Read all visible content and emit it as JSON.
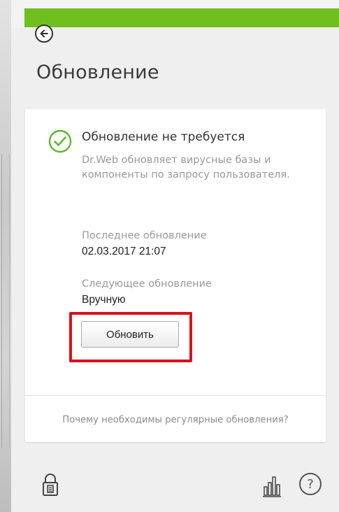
{
  "header": {
    "title": "Обновление",
    "back_icon": "arrow-left-icon",
    "accent_color": "#6fbf1f"
  },
  "status": {
    "icon": "check-circle-icon",
    "icon_color": "#5cb82a",
    "title": "Обновление не требуется",
    "description": "Dr.Web обновляет вирусные базы и компоненты по запросу пользователя."
  },
  "last_update": {
    "label": "Последнее обновление",
    "value": "02.03.2017 21:07"
  },
  "next_update": {
    "label": "Следующее обновление",
    "value": "Вручную"
  },
  "actions": {
    "update_label": "Обновить",
    "highlight_color": "#d8121a"
  },
  "footer": {
    "link": "Почему необходимы регулярные обновления?",
    "icons": [
      "lock-icon",
      "stats-icon",
      "help-icon"
    ],
    "help_glyph": "?"
  }
}
